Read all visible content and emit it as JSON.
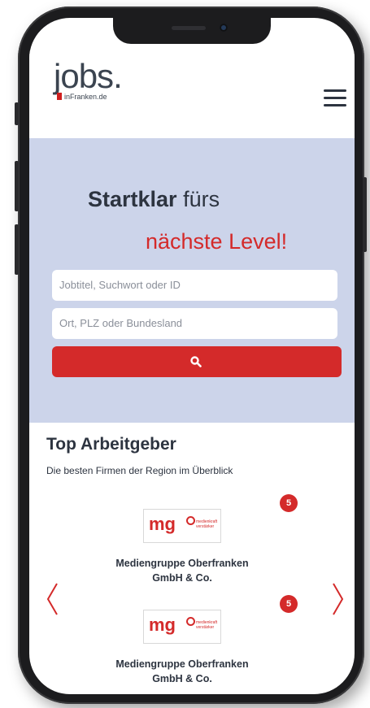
{
  "header": {
    "logo_word": "jobs",
    "logo_dot": ".",
    "logo_sub": "inFranken.de"
  },
  "hero": {
    "headline_bold": "Startklar",
    "headline_rest": " fürs",
    "headline_accent": "nächste Level!"
  },
  "search": {
    "keyword_placeholder": "Jobtitel, Suchwort oder ID",
    "location_placeholder": "Ort, PLZ oder Bundesland",
    "button_icon": "search-icon"
  },
  "employers": {
    "title": "Top Arbeitgeber",
    "subtitle": "Die besten Firmen der Region im Überblick",
    "logo_text": "mg",
    "logo_tagline_1": "medienkraft",
    "logo_tagline_2": "verstärker",
    "items": [
      {
        "badge": "5",
        "name_line1": "Mediengruppe Oberfranken",
        "name_line2": "GmbH & Co."
      },
      {
        "badge": "5",
        "name_line1": "Mediengruppe Oberfranken",
        "name_line2": "GmbH & Co."
      }
    ]
  },
  "colors": {
    "accent": "#d42a2a",
    "hero_bg": "#ccd4ea",
    "text": "#2d3440"
  }
}
